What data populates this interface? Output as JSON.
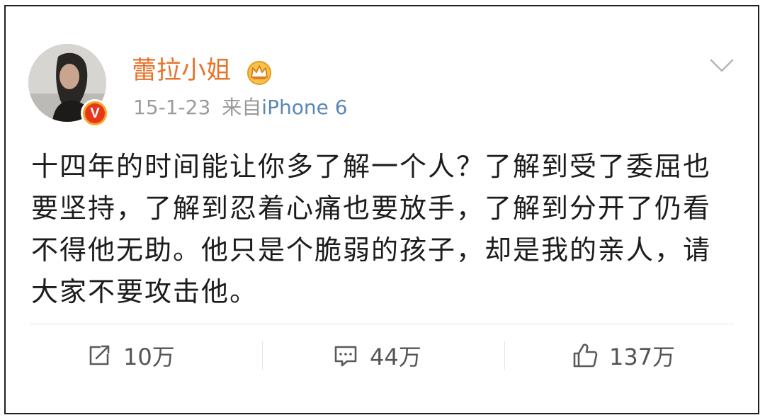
{
  "post": {
    "username": "蕾拉小姐",
    "date": "15-1-23",
    "source_prefix": "来自",
    "source": "iPhone 6",
    "content_lines": [
      "十四年的时间能让你多了解一个人？了解到受了委屈也",
      "要坚持，了解到忍着心痛也要放手，了解到分开了仍看",
      "不得他无助。他只是个脆弱的孩子，却是我的亲人，请",
      "大家不要攻击他。"
    ]
  },
  "badges": {
    "verified": "V",
    "verified_icon": "verified-v-badge",
    "vip_icon": "crown-icon"
  },
  "actions": {
    "repost": {
      "icon": "repost-icon",
      "count": "10万"
    },
    "comment": {
      "icon": "comment-icon",
      "count": "44万"
    },
    "like": {
      "icon": "thumbs-up-icon",
      "count": "137万"
    }
  },
  "colors": {
    "username": "#e8732b",
    "source_link": "#5b87b5",
    "meta_text": "#9b9b9b",
    "body_text": "#1c1c1c",
    "verified_red": "#e8361c",
    "verified_ring": "#f5a623"
  }
}
